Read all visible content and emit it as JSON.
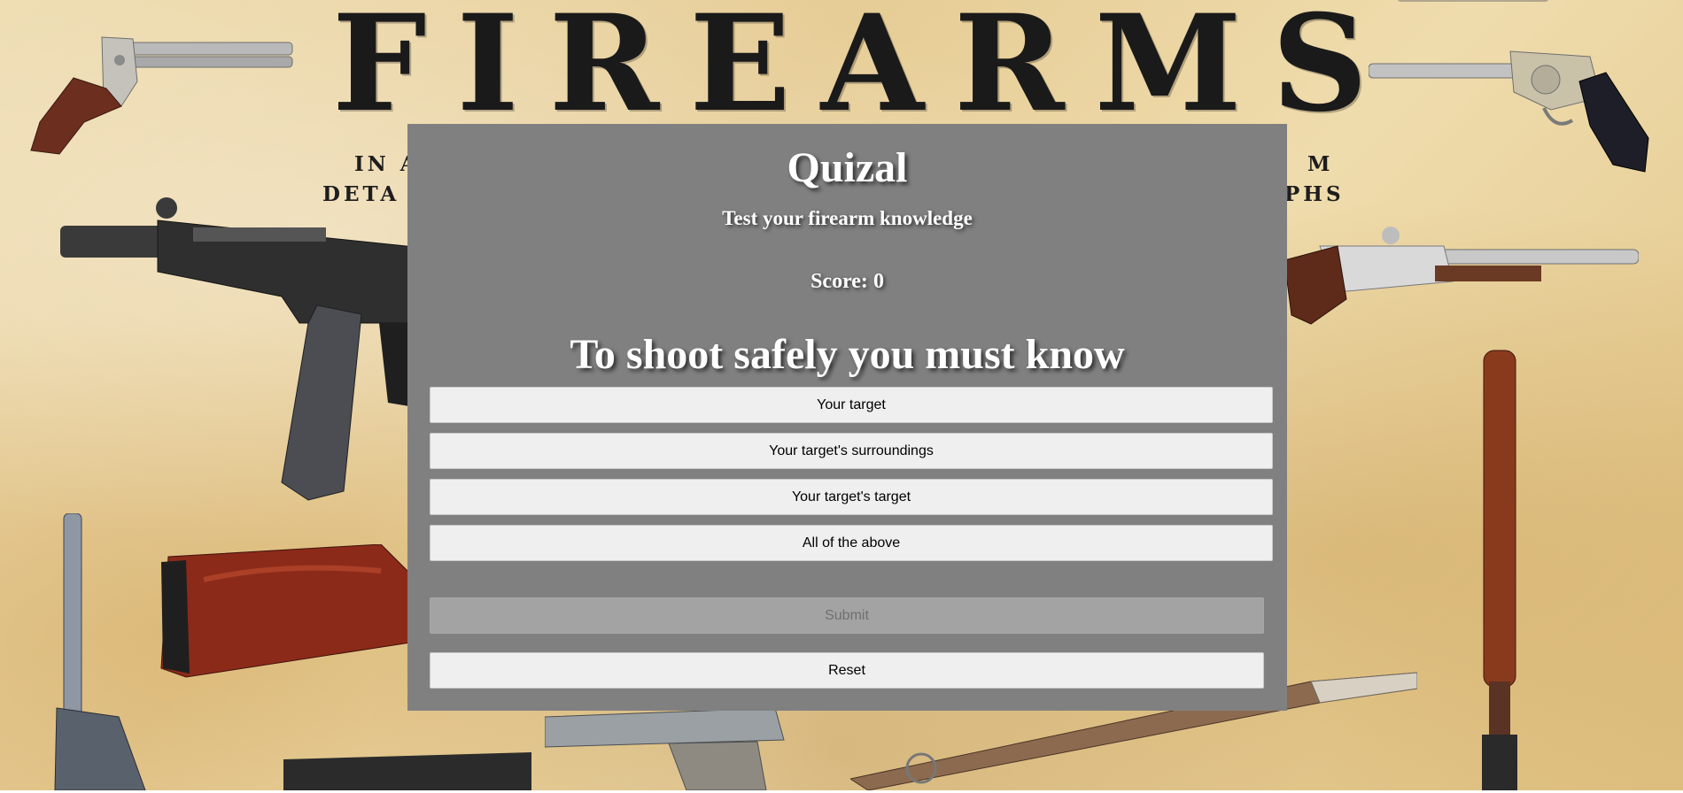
{
  "background": {
    "title": "FIREARMS",
    "subtitle_left_line1": "IN A",
    "subtitle_left_line2": "DETA",
    "subtitle_right_line1": "M",
    "subtitle_right_line2": "PHS"
  },
  "quiz": {
    "title": "Quizal",
    "subtitle": "Test your firearm knowledge",
    "score_label": "Score:",
    "score_value": "0",
    "question": "To shoot safely you must know",
    "answers": [
      "Your target",
      "Your target's surroundings",
      "Your target's target",
      "All of the above"
    ],
    "submit_label": "Submit",
    "submit_disabled": true,
    "reset_label": "Reset"
  },
  "colors": {
    "panel": "#808080",
    "answer_button": "#efefef",
    "submit_disabled": "#a3a3a3",
    "text_light": "#ffffff"
  }
}
